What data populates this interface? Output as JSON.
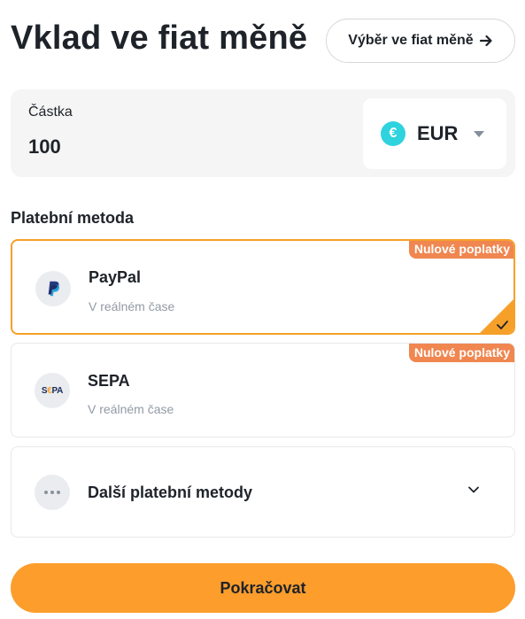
{
  "header": {
    "title": "Vklad ve fiat měně",
    "withdraw_label": "Výběr ve fiat měně",
    "withdraw_icon": "arrow-right-icon"
  },
  "amount": {
    "label": "Částka",
    "value": "100",
    "currency_code": "EUR",
    "currency_symbol": "€",
    "currency_icon_color": "#2ed3de"
  },
  "payment": {
    "section_label": "Platební metoda",
    "methods": [
      {
        "name": "PayPal",
        "subtitle": "V reálném čase",
        "badge": "Nulové poplatky",
        "icon": "paypal-icon",
        "selected": true
      },
      {
        "name": "SEPA",
        "subtitle": "V reálném čase",
        "badge": "Nulové poplatky",
        "icon": "sepa-icon",
        "logo_text_1": "S",
        "logo_text_2": "€",
        "logo_text_3": "PA",
        "selected": false
      }
    ],
    "more_label": "Další platební metody"
  },
  "colors": {
    "accent": "#fc9d2c",
    "selected_border": "#f6a02a",
    "badge": "#f08650"
  },
  "footer": {
    "continue_label": "Pokračovat"
  }
}
